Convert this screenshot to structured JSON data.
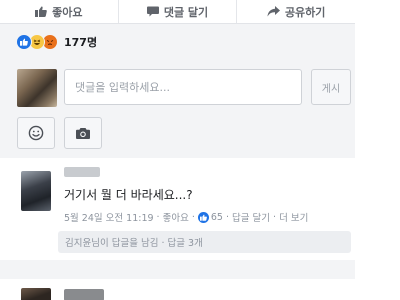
{
  "action_bar": {
    "like_label": "좋아요",
    "comment_label": "댓글 달기",
    "share_label": "공유하기"
  },
  "reactions": {
    "count": "177명",
    "icons": [
      "like-icon",
      "haha-icon",
      "angry-icon"
    ]
  },
  "composer": {
    "placeholder": "댓글을 입력하세요...",
    "value": "",
    "post_label": "게시"
  },
  "comment": {
    "text": "거기서 뭘 더 바라세요...?",
    "meta": {
      "timestamp": "5월 24일 오전 11:19",
      "like_link": "좋아요",
      "like_count": "65",
      "reply_link": "답글 달기",
      "more_link": "더 보기"
    },
    "replies_summary": "김지윤님이 답글을 남김 · 답글 3개"
  },
  "colors": {
    "accent": "#1f73e6",
    "background": "#f3f4f6"
  }
}
